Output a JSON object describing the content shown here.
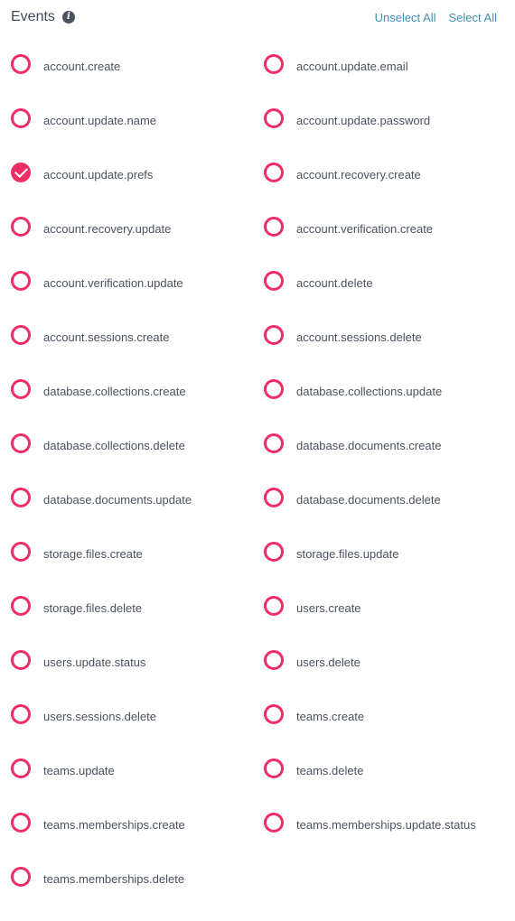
{
  "header": {
    "title": "Events",
    "info_icon": "info-icon",
    "unselect_all": "Unselect All",
    "select_all": "Select All"
  },
  "colors": {
    "accent": "#f02e65",
    "link": "#3d8fb4"
  },
  "events": [
    {
      "name": "account.create",
      "checked": false
    },
    {
      "name": "account.update.email",
      "checked": false
    },
    {
      "name": "account.update.name",
      "checked": false
    },
    {
      "name": "account.update.password",
      "checked": false
    },
    {
      "name": "account.update.prefs",
      "checked": true
    },
    {
      "name": "account.recovery.create",
      "checked": false
    },
    {
      "name": "account.recovery.update",
      "checked": false
    },
    {
      "name": "account.verification.create",
      "checked": false
    },
    {
      "name": "account.verification.update",
      "checked": false
    },
    {
      "name": "account.delete",
      "checked": false
    },
    {
      "name": "account.sessions.create",
      "checked": false
    },
    {
      "name": "account.sessions.delete",
      "checked": false
    },
    {
      "name": "database.collections.create",
      "checked": false
    },
    {
      "name": "database.collections.update",
      "checked": false
    },
    {
      "name": "database.collections.delete",
      "checked": false
    },
    {
      "name": "database.documents.create",
      "checked": false
    },
    {
      "name": "database.documents.update",
      "checked": false
    },
    {
      "name": "database.documents.delete",
      "checked": false
    },
    {
      "name": "storage.files.create",
      "checked": false
    },
    {
      "name": "storage.files.update",
      "checked": false
    },
    {
      "name": "storage.files.delete",
      "checked": false
    },
    {
      "name": "users.create",
      "checked": false
    },
    {
      "name": "users.update.status",
      "checked": false
    },
    {
      "name": "users.delete",
      "checked": false
    },
    {
      "name": "users.sessions.delete",
      "checked": false
    },
    {
      "name": "teams.create",
      "checked": false
    },
    {
      "name": "teams.update",
      "checked": false
    },
    {
      "name": "teams.delete",
      "checked": false
    },
    {
      "name": "teams.memberships.create",
      "checked": false
    },
    {
      "name": "teams.memberships.update.status",
      "checked": false
    },
    {
      "name": "teams.memberships.delete",
      "checked": false
    }
  ]
}
